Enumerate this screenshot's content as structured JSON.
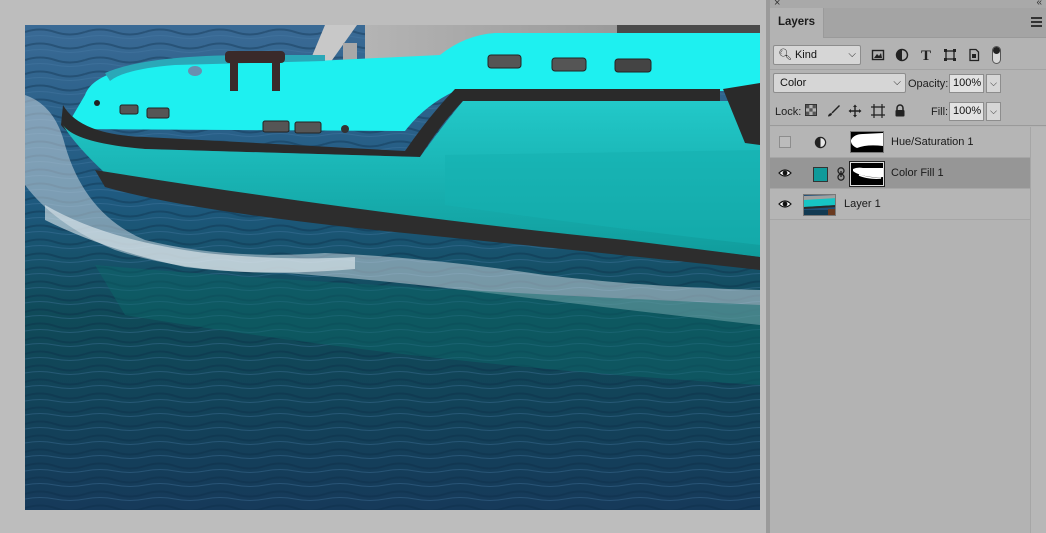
{
  "panel": {
    "close_glyph": "×",
    "collapse_glyph": "«",
    "tab_label": "Layers",
    "menu_icon": "hamburger-menu-icon",
    "filter": {
      "kind_label": "Kind",
      "icons": [
        "image-filter-icon",
        "adjustment-filter-icon",
        "type-filter-icon",
        "shape-filter-icon",
        "smart-object-filter-icon"
      ]
    },
    "blend_mode": "Color",
    "opacity_label": "Opacity:",
    "opacity_value": "100%",
    "lock_label": "Lock:",
    "lock_icons": [
      "lock-transparent-pixels-icon",
      "lock-image-pixels-icon",
      "lock-position-icon",
      "lock-artboard-icon",
      "lock-all-icon"
    ],
    "fill_label": "Fill:",
    "fill_value": "100%"
  },
  "layers": [
    {
      "name": "Hue/Saturation 1",
      "visible": false,
      "type": "adjustment"
    },
    {
      "name": "Color Fill 1",
      "visible": true,
      "type": "fill",
      "fill_color": "#0f9a9a",
      "selected": true
    },
    {
      "name": "Layer 1",
      "visible": true,
      "type": "pixel"
    }
  ],
  "colors": {
    "boat_cyan": "#19e6e6",
    "boat_hull": "#17b8b8",
    "water": "#1e4f70"
  }
}
